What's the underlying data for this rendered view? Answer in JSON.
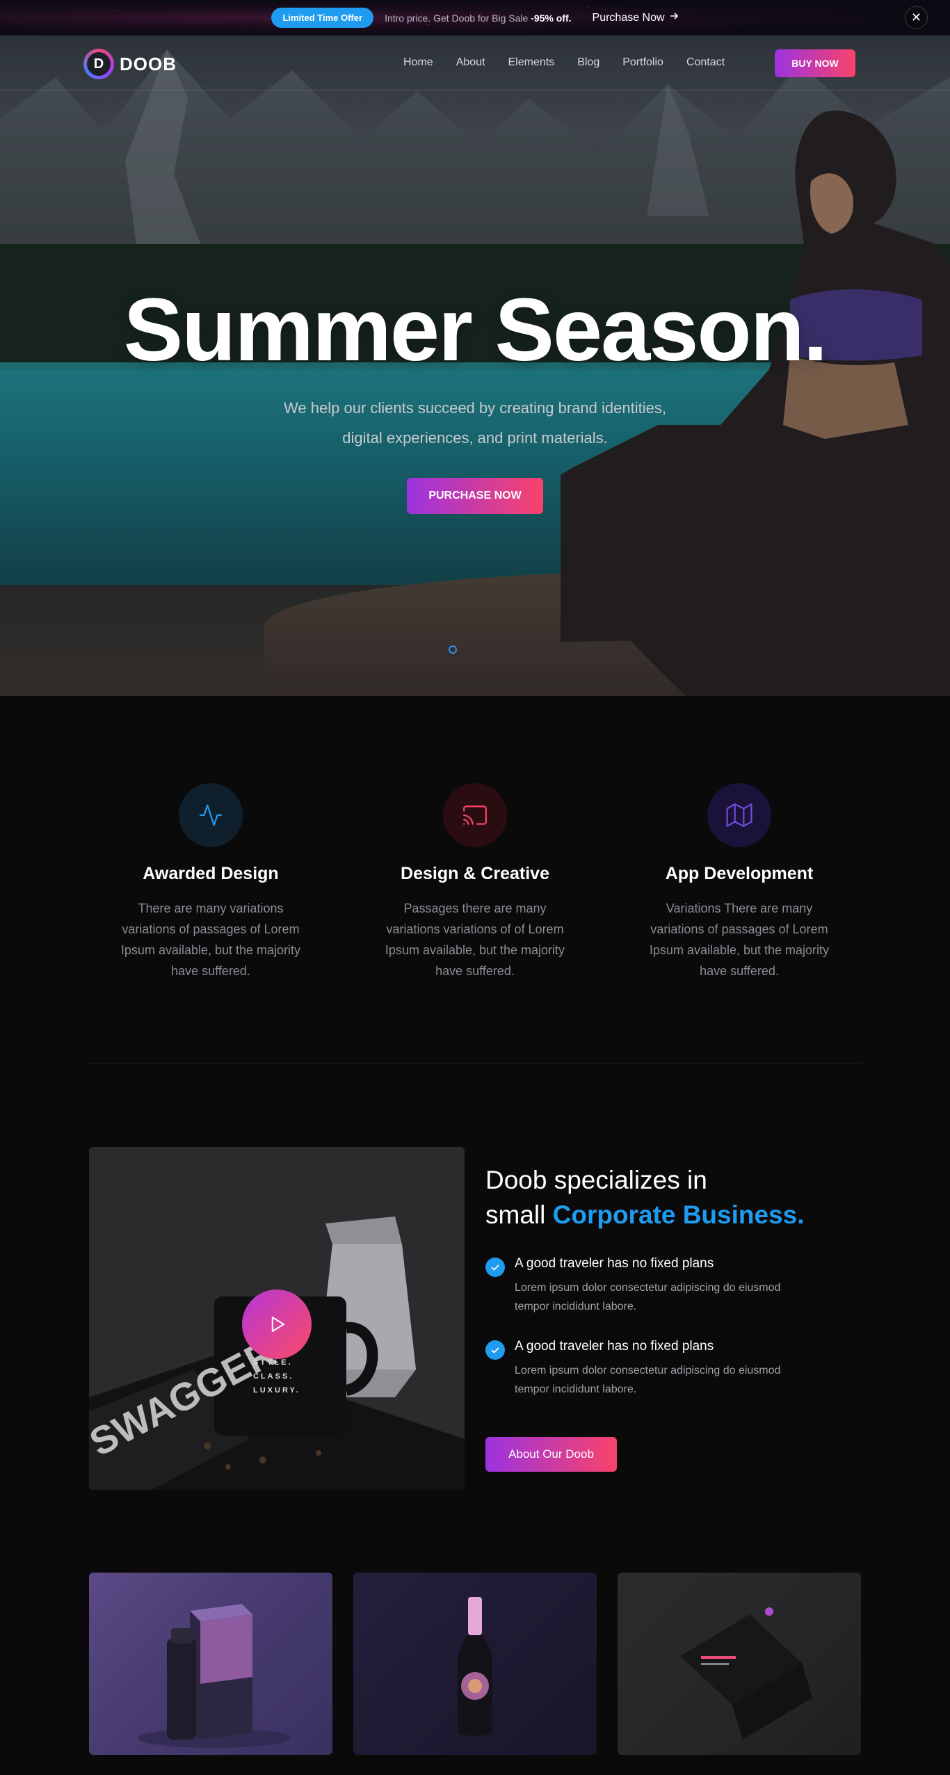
{
  "banner": {
    "pill": "Limited Time Offer",
    "text": "Intro price. Get Doob for Big Sale",
    "discount": "-95% off.",
    "link": "Purchase Now",
    "close": "✕"
  },
  "nav": {
    "logo": "DOOB",
    "logo_letter": "D",
    "links": [
      "Home",
      "About",
      "Elements",
      "Blog",
      "Portfolio",
      "Contact"
    ],
    "cta": "BUY NOW"
  },
  "hero": {
    "title": "Summer Season.",
    "subtitle_line1": "We help our clients succeed by creating brand identities,",
    "subtitle_line2": "digital experiences, and print materials.",
    "button": "PURCHASE NOW"
  },
  "services": [
    {
      "icon": "activity-icon",
      "color": "#1f9bf0",
      "bg": "#0f1f2c",
      "title": "Awarded Design",
      "desc": "There are many variations variations of passages of Lorem Ipsum available, but the majority have suffered."
    },
    {
      "icon": "cast-icon",
      "color": "#f9436a",
      "bg": "#2a0d10",
      "title": "Design & Creative",
      "desc": "Passages there are many variations variations of of Lorem Ipsum available, but the majority have suffered."
    },
    {
      "icon": "map-icon",
      "color": "#6b4fd8",
      "bg": "#1a1238",
      "title": "App Development",
      "desc": "Variations There are many variations of passages of Lorem Ipsum available, but the majority have suffered."
    }
  ],
  "about": {
    "heading_line1": "Doob specializes in",
    "heading_line2_plain": "small ",
    "heading_line2_accent": "Corporate Business.",
    "features": [
      {
        "title": "A good traveler has no fixed plans",
        "desc": "Lorem ipsum dolor consectetur adipiscing do eiusmod tempor incididunt labore."
      },
      {
        "title": "A good traveler has no fixed plans",
        "desc": "Lorem ipsum dolor consectetur adipiscing do eiusmod tempor incididunt labore."
      }
    ],
    "button": "About Our Doob",
    "mug_text": "STYLE.\nCLASS.\nLUXURY.",
    "magazine_text": "SWAGGER"
  },
  "colors": {
    "accent_blue": "#1f9bf0",
    "gradient_start": "#9b33e0",
    "gradient_end": "#f9436a",
    "background": "#0a0a0b"
  }
}
